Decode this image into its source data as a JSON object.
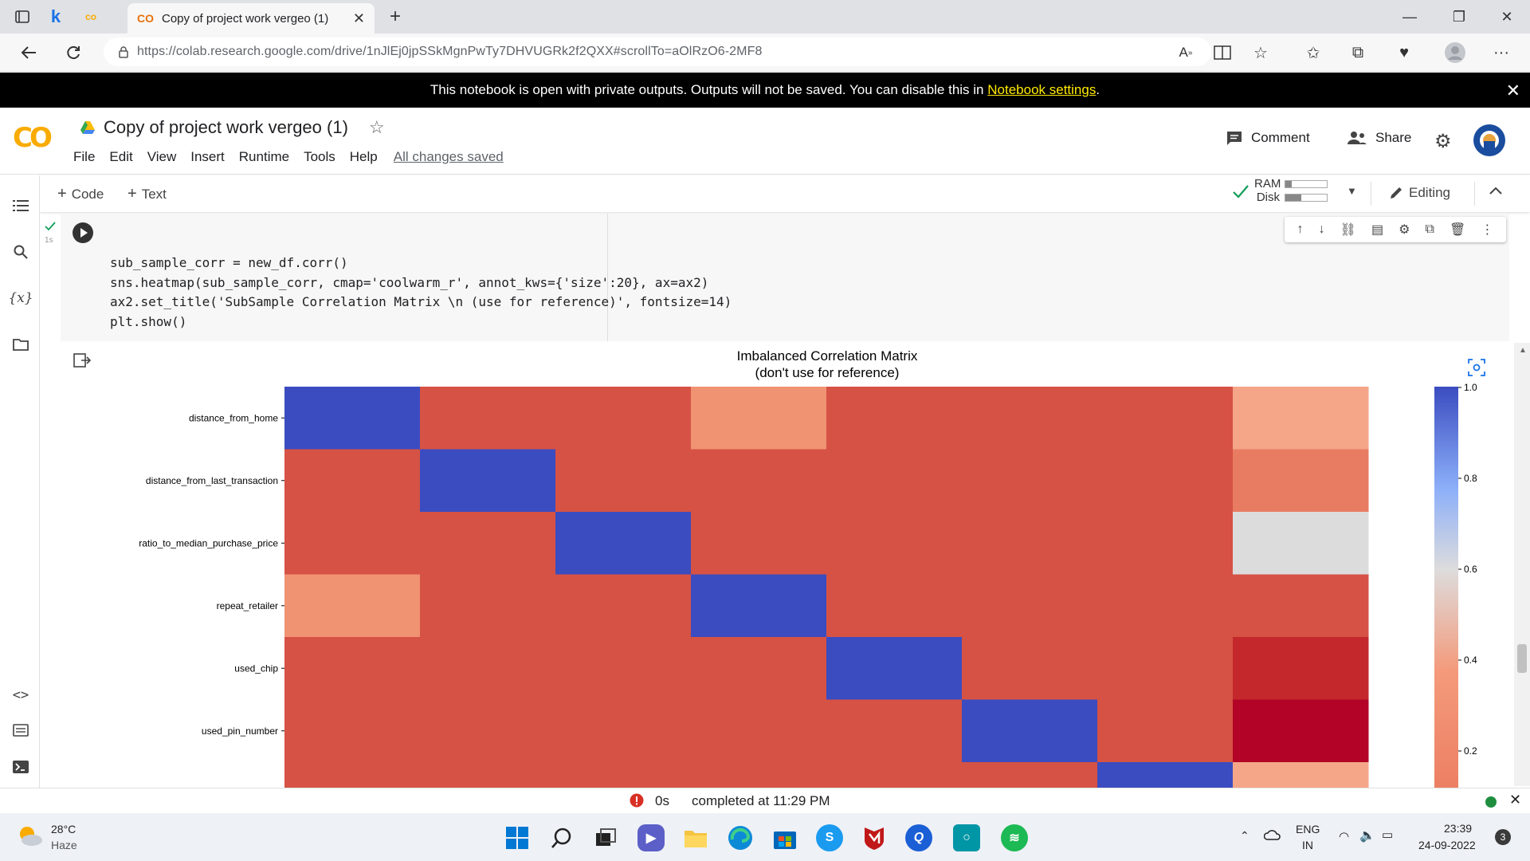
{
  "browser": {
    "tab_title": "Copy of project work vergeo (1)",
    "tab_favicon": "CO",
    "url": "https://colab.research.google.com/drive/1nJlEj0jpSSkMgnPwTy7DHVUGRk2f2QXX#scrollTo=aOlRzO6-2MF8"
  },
  "banner": {
    "text": "This notebook is open with private outputs. Outputs will not be saved. You can disable this in ",
    "link": "Notebook settings",
    "suffix": "."
  },
  "colab": {
    "logo": "CO",
    "title": "Copy of project work vergeo (1)",
    "menu": [
      "File",
      "Edit",
      "View",
      "Insert",
      "Runtime",
      "Tools",
      "Help"
    ],
    "save_status": "All changes saved",
    "comment_label": "Comment",
    "share_label": "Share"
  },
  "toolbar": {
    "code_label": "Code",
    "text_label": "Text",
    "ram_label": "RAM",
    "disk_label": "Disk",
    "editing_label": "Editing"
  },
  "cell": {
    "exec_time": "1s",
    "code": [
      "sub_sample_corr = new_df.corr()",
      "sns.heatmap(sub_sample_corr, cmap='coolwarm_r', annot_kws={'size':20}, ax=ax2)",
      "ax2.set_title('SubSample Correlation Matrix \\n (use for reference)', fontsize=14)",
      "plt.show()"
    ]
  },
  "chart_data": {
    "type": "heatmap",
    "title": "Imbalanced Correlation Matrix\n(don't use for reference)",
    "title_lines": [
      "Imbalanced Correlation Matrix",
      "(don't use for reference)"
    ],
    "y_labels": [
      "distance_from_home",
      "distance_from_last_transaction",
      "ratio_to_median_purchase_price",
      "repeat_retailer",
      "used_chip",
      "used_pin_number"
    ],
    "colorbar_ticks": [
      "1.0",
      "0.8",
      "0.6",
      "0.4",
      "0.2"
    ],
    "colormap": "coolwarm_r",
    "visible_rows": 7,
    "columns": 8,
    "values": [
      [
        1.0,
        0.0,
        0.0,
        0.14,
        0.0,
        0.0,
        0.0,
        0.19
      ],
      [
        0.0,
        1.0,
        0.0,
        0.0,
        0.0,
        0.0,
        0.0,
        0.09
      ],
      [
        0.0,
        0.0,
        1.0,
        0.0,
        0.0,
        0.0,
        0.0,
        0.46
      ],
      [
        0.14,
        0.0,
        0.0,
        1.0,
        0.0,
        0.0,
        0.0,
        0.0
      ],
      [
        0.0,
        0.0,
        0.0,
        0.0,
        1.0,
        0.0,
        0.0,
        -0.06
      ],
      [
        0.0,
        0.0,
        0.0,
        0.0,
        0.0,
        1.0,
        0.0,
        -0.1
      ],
      [
        0.0,
        0.0,
        0.0,
        0.0,
        0.0,
        0.0,
        1.0,
        0.19
      ]
    ]
  },
  "statusbar": {
    "duration": "0s",
    "completed": "completed at 11:29 PM"
  },
  "taskbar": {
    "weather_temp": "28°C",
    "weather_desc": "Haze",
    "lang": "ENG",
    "region": "IN",
    "time": "23:39",
    "date": "24-09-2022",
    "notif_count": "3"
  },
  "colors": {
    "banner_link": "#ffea00",
    "colab_orange": "#f9ab00",
    "heat_blue": "#3b4cc0",
    "heat_red": "#d65244"
  }
}
